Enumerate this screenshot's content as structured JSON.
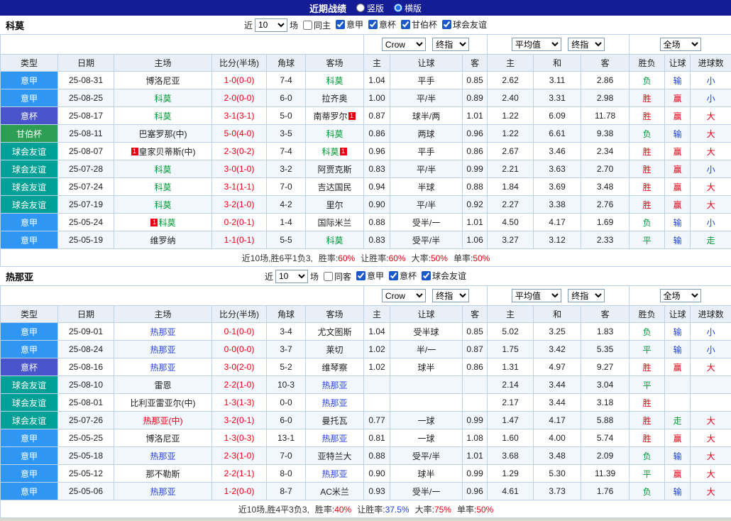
{
  "page": {
    "title": "近期战绩",
    "vertical": {
      "label": "竖版",
      "checked": false
    },
    "horizontal": {
      "label": "横版",
      "checked": true
    }
  },
  "colors": {
    "topbar_bg": "#141C96",
    "league": {
      "意甲": "#2F96F3",
      "意杯": "#4A55CB",
      "甘伯杯": "#2E9E54",
      "球会友谊": "#00A096"
    },
    "team": {
      "plain": "#222222",
      "mark": "#E60012"
    },
    "result": {
      "胜": "#E60012",
      "平": "#009933",
      "负": "#009933",
      "赢": "#E60012",
      "输": "#1A3EE8",
      "走": "#009933",
      "大": "#E60012",
      "小": "#1A3EE8"
    },
    "stat": {
      "red": "#E60012",
      "blue": "#1A3EE8"
    },
    "score": "#E60012",
    "badge": "#E60012",
    "grid": "#BCD2E8",
    "header_bg": "#E8EFF7",
    "row_alt": "#F2F7FD"
  },
  "tables": [
    {
      "team": "科莫",
      "focal_color": "#009933",
      "filter": {
        "near": "近",
        "count": "10",
        "unit": "场",
        "same_label": "同主",
        "same_checked": false,
        "leagues": [
          {
            "label": "意甲",
            "checked": true
          },
          {
            "label": "意杯",
            "checked": true
          },
          {
            "label": "甘伯杯",
            "checked": true
          },
          {
            "label": "球会友谊",
            "checked": true
          }
        ]
      },
      "selects": {
        "bookmaker": "Crow",
        "asian_time": "终指",
        "euro_source": "平均值",
        "euro_time": "终指",
        "scope": "全场"
      },
      "headers": [
        "类型",
        "日期",
        "主场",
        "比分(半场)",
        "角球",
        "客场",
        "主",
        "让球",
        "客",
        "主",
        "和",
        "客",
        "胜负",
        "让球",
        "进球数"
      ],
      "rows": [
        {
          "type": "意甲",
          "date": "25-08-31",
          "home": "博洛尼亚",
          "home_c": "plain",
          "score": "1-0(0-0)",
          "corners": "7-4",
          "away": "科莫",
          "away_c": "focal",
          "ah": [
            "1.04",
            "平手",
            "0.85"
          ],
          "eu": [
            "2.62",
            "3.11",
            "2.86"
          ],
          "res": [
            "负",
            "输",
            "小"
          ]
        },
        {
          "type": "意甲",
          "date": "25-08-25",
          "home": "科莫",
          "home_c": "focal",
          "score": "2-0(0-0)",
          "corners": "6-0",
          "away": "拉齐奥",
          "away_c": "plain",
          "ah": [
            "1.00",
            "平/半",
            "0.89"
          ],
          "eu": [
            "2.40",
            "3.31",
            "2.98"
          ],
          "res": [
            "胜",
            "赢",
            "小"
          ]
        },
        {
          "type": "意杯",
          "date": "25-08-17",
          "home": "科莫",
          "home_c": "focal",
          "score": "3-1(3-1)",
          "corners": "5-0",
          "away": "南蒂罗尔",
          "away_c": "plain",
          "away_badge": "1",
          "ah": [
            "0.87",
            "球半/两",
            "1.01"
          ],
          "eu": [
            "1.22",
            "6.09",
            "11.78"
          ],
          "res": [
            "胜",
            "赢",
            "大"
          ]
        },
        {
          "type": "甘伯杯",
          "date": "25-08-11",
          "home": "巴塞罗那(中)",
          "home_c": "plain",
          "score": "5-0(4-0)",
          "corners": "3-5",
          "away": "科莫",
          "away_c": "focal",
          "ah": [
            "0.86",
            "两球",
            "0.96"
          ],
          "eu": [
            "1.22",
            "6.61",
            "9.38"
          ],
          "res": [
            "负",
            "输",
            "大"
          ]
        },
        {
          "type": "球会友谊",
          "date": "25-08-07",
          "home": "皇家贝蒂斯(中)",
          "home_c": "plain",
          "home_badge": "1",
          "score": "2-3(0-2)",
          "corners": "7-4",
          "away": "科莫",
          "away_c": "focal",
          "away_badge": "1",
          "ah": [
            "0.96",
            "平手",
            "0.86"
          ],
          "eu": [
            "2.67",
            "3.46",
            "2.34"
          ],
          "res": [
            "胜",
            "赢",
            "大"
          ]
        },
        {
          "type": "球会友谊",
          "date": "25-07-28",
          "home": "科莫",
          "home_c": "focal",
          "score": "3-0(1-0)",
          "corners": "3-2",
          "away": "阿贾克斯",
          "away_c": "plain",
          "ah": [
            "0.83",
            "平/半",
            "0.99"
          ],
          "eu": [
            "2.21",
            "3.63",
            "2.70"
          ],
          "res": [
            "胜",
            "赢",
            "小"
          ]
        },
        {
          "type": "球会友谊",
          "date": "25-07-24",
          "home": "科莫",
          "home_c": "focal",
          "score": "3-1(1-1)",
          "corners": "7-0",
          "away": "吉达国民",
          "away_c": "plain",
          "ah": [
            "0.94",
            "半球",
            "0.88"
          ],
          "eu": [
            "1.84",
            "3.69",
            "3.48"
          ],
          "res": [
            "胜",
            "赢",
            "大"
          ]
        },
        {
          "type": "球会友谊",
          "date": "25-07-19",
          "home": "科莫",
          "home_c": "focal",
          "score": "3-2(1-0)",
          "corners": "4-2",
          "away": "里尔",
          "away_c": "plain",
          "ah": [
            "0.90",
            "平/半",
            "0.92"
          ],
          "eu": [
            "2.27",
            "3.38",
            "2.76"
          ],
          "res": [
            "胜",
            "赢",
            "大"
          ]
        },
        {
          "type": "意甲",
          "date": "25-05-24",
          "home": "科莫",
          "home_c": "focal",
          "home_badge": "1",
          "score": "0-2(0-1)",
          "corners": "1-4",
          "away": "国际米兰",
          "away_c": "plain",
          "ah": [
            "0.88",
            "受半/一",
            "1.01"
          ],
          "eu": [
            "4.50",
            "4.17",
            "1.69"
          ],
          "res": [
            "负",
            "输",
            "小"
          ]
        },
        {
          "type": "意甲",
          "date": "25-05-19",
          "home": "维罗纳",
          "home_c": "plain",
          "score": "1-1(0-1)",
          "corners": "5-5",
          "away": "科莫",
          "away_c": "focal",
          "ah": [
            "0.83",
            "受平/半",
            "1.06"
          ],
          "eu": [
            "3.27",
            "3.12",
            "2.33"
          ],
          "res": [
            "平",
            "输",
            "走"
          ]
        }
      ],
      "summary": {
        "prefix": "近10场,胜6平1负3,",
        "stats": [
          {
            "label": "胜率:",
            "value": "60%",
            "color": "red"
          },
          {
            "label": "让胜率:",
            "value": "60%",
            "color": "red"
          },
          {
            "label": "大率:",
            "value": "50%",
            "color": "red"
          },
          {
            "label": "单率:",
            "value": "50%",
            "color": "red"
          }
        ]
      }
    },
    {
      "team": "热那亚",
      "focal_color": "#2945D8",
      "filter": {
        "near": "近",
        "count": "10",
        "unit": "场",
        "same_label": "同客",
        "same_checked": false,
        "leagues": [
          {
            "label": "意甲",
            "checked": true
          },
          {
            "label": "意杯",
            "checked": true
          },
          {
            "label": "球会友谊",
            "checked": true
          }
        ]
      },
      "selects": {
        "bookmaker": "Crow",
        "asian_time": "终指",
        "euro_source": "平均值",
        "euro_time": "终指",
        "scope": "全场"
      },
      "headers": [
        "类型",
        "日期",
        "主场",
        "比分(半场)",
        "角球",
        "客场",
        "主",
        "让球",
        "客",
        "主",
        "和",
        "客",
        "胜负",
        "让球",
        "进球数"
      ],
      "rows": [
        {
          "type": "意甲",
          "date": "25-09-01",
          "home": "热那亚",
          "home_c": "focal",
          "score": "0-1(0-0)",
          "corners": "3-4",
          "away": "尤文图斯",
          "away_c": "plain",
          "ah": [
            "1.04",
            "受半球",
            "0.85"
          ],
          "eu": [
            "5.02",
            "3.25",
            "1.83"
          ],
          "res": [
            "负",
            "输",
            "小"
          ]
        },
        {
          "type": "意甲",
          "date": "25-08-24",
          "home": "热那亚",
          "home_c": "focal",
          "score": "0-0(0-0)",
          "corners": "3-7",
          "away": "莱切",
          "away_c": "plain",
          "ah": [
            "1.02",
            "半/一",
            "0.87"
          ],
          "eu": [
            "1.75",
            "3.42",
            "5.35"
          ],
          "res": [
            "平",
            "输",
            "小"
          ]
        },
        {
          "type": "意杯",
          "date": "25-08-16",
          "home": "热那亚",
          "home_c": "focal",
          "score": "3-0(2-0)",
          "corners": "5-2",
          "away": "维琴察",
          "away_c": "plain",
          "ah": [
            "1.02",
            "球半",
            "0.86"
          ],
          "eu": [
            "1.31",
            "4.97",
            "9.27"
          ],
          "res": [
            "胜",
            "赢",
            "大"
          ]
        },
        {
          "type": "球会友谊",
          "date": "25-08-10",
          "home": "雷恩",
          "home_c": "plain",
          "score": "2-2(1-0)",
          "corners": "10-3",
          "away": "热那亚",
          "away_c": "focal",
          "ah": [
            "",
            "",
            ""
          ],
          "eu": [
            "2.14",
            "3.44",
            "3.04"
          ],
          "res": [
            "平",
            "",
            ""
          ]
        },
        {
          "type": "球会友谊",
          "date": "25-08-01",
          "home": "比利亚雷亚尔(中)",
          "home_c": "plain",
          "score": "1-3(1-3)",
          "corners": "0-0",
          "away": "热那亚",
          "away_c": "focal",
          "ah": [
            "",
            "",
            ""
          ],
          "eu": [
            "2.17",
            "3.44",
            "3.18"
          ],
          "res": [
            "胜",
            "",
            ""
          ]
        },
        {
          "type": "球会友谊",
          "date": "25-07-26",
          "home": "热那亚(中)",
          "home_c": "mark",
          "score": "3-2(0-1)",
          "corners": "6-0",
          "away": "曼托瓦",
          "away_c": "plain",
          "ah": [
            "0.77",
            "一球",
            "0.99"
          ],
          "eu": [
            "1.47",
            "4.17",
            "5.88"
          ],
          "res": [
            "胜",
            "走",
            "大"
          ]
        },
        {
          "type": "意甲",
          "date": "25-05-25",
          "home": "博洛尼亚",
          "home_c": "plain",
          "score": "1-3(0-3)",
          "corners": "13-1",
          "away": "热那亚",
          "away_c": "focal",
          "ah": [
            "0.81",
            "一球",
            "1.08"
          ],
          "eu": [
            "1.60",
            "4.00",
            "5.74"
          ],
          "res": [
            "胜",
            "赢",
            "大"
          ]
        },
        {
          "type": "意甲",
          "date": "25-05-18",
          "home": "热那亚",
          "home_c": "focal",
          "score": "2-3(1-0)",
          "corners": "7-0",
          "away": "亚特兰大",
          "away_c": "plain",
          "ah": [
            "0.88",
            "受平/半",
            "1.01"
          ],
          "eu": [
            "3.68",
            "3.48",
            "2.09"
          ],
          "res": [
            "负",
            "输",
            "大"
          ]
        },
        {
          "type": "意甲",
          "date": "25-05-12",
          "home": "那不勒斯",
          "home_c": "plain",
          "score": "2-2(1-1)",
          "corners": "8-0",
          "away": "热那亚",
          "away_c": "focal",
          "ah": [
            "0.90",
            "球半",
            "0.99"
          ],
          "eu": [
            "1.29",
            "5.30",
            "11.39"
          ],
          "res": [
            "平",
            "赢",
            "大"
          ]
        },
        {
          "type": "意甲",
          "date": "25-05-06",
          "home": "热那亚",
          "home_c": "focal",
          "score": "1-2(0-0)",
          "corners": "8-7",
          "away": "AC米兰",
          "away_c": "plain",
          "ah": [
            "0.93",
            "受半/一",
            "0.96"
          ],
          "eu": [
            "4.61",
            "3.73",
            "1.76"
          ],
          "res": [
            "负",
            "输",
            "大"
          ]
        }
      ],
      "summary": {
        "prefix": "近10场,胜4平3负3,",
        "stats": [
          {
            "label": "胜率:",
            "value": "40%",
            "color": "red"
          },
          {
            "label": "让胜率:",
            "value": "37.5%",
            "color": "blue"
          },
          {
            "label": "大率:",
            "value": "75%",
            "color": "red"
          },
          {
            "label": "单率:",
            "value": "50%",
            "color": "red"
          }
        ]
      }
    }
  ]
}
